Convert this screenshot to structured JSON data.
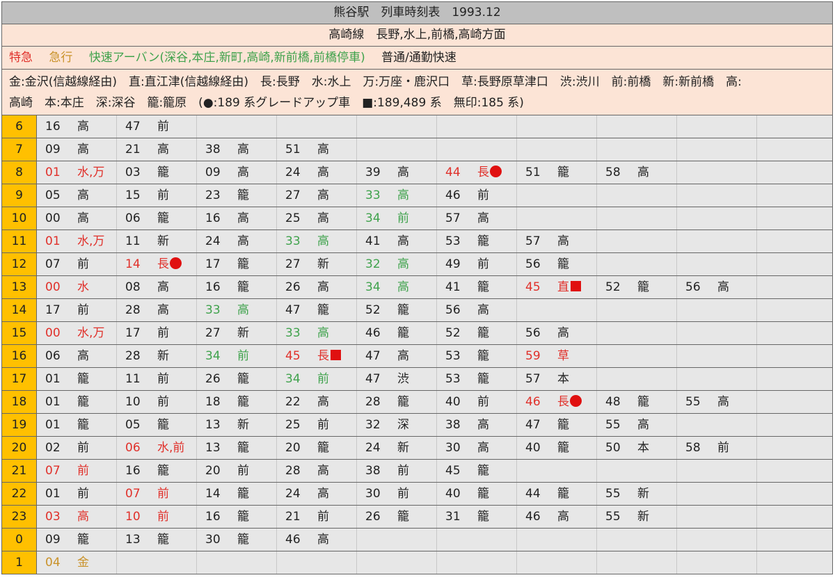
{
  "header": {
    "title": "熊谷駅　列車時刻表　1993.12",
    "line": "高崎線　長野,水上,前橋,高崎方面"
  },
  "legend": {
    "limited": "特急",
    "express": "急行",
    "rapid": "快速アーバン(深谷,本庄,新町,高崎,新前橋,前橋停車)",
    "local": "普通/通勤快速"
  },
  "abbreviations": {
    "line1": "金:金沢(信越線経由)　直:直江津(信越線経由)　長:長野　水:水上　万:万座・鹿沢口　草:長野原草津口　渋:渋川　前:前橋　新:新前橋　高:",
    "line2": "高崎　本:本庄　深:深谷　籠:籠原　(●:189 系グレードアップ車　■:189,489 系　無印:185 系)"
  },
  "colors": {
    "limited": "#e0302a",
    "express": "#c9922a",
    "rapid": "#3fa24c",
    "local": "#222222",
    "hour_bg": "#ffc000",
    "header_bg": "#bfbfbf",
    "info_bg": "#fce4d6"
  },
  "timetable": [
    {
      "hour": "6",
      "deps": [
        {
          "m": "16",
          "d": "高",
          "t": "local"
        },
        {
          "m": "47",
          "d": "前",
          "t": "local"
        }
      ]
    },
    {
      "hour": "7",
      "deps": [
        {
          "m": "09",
          "d": "高",
          "t": "local"
        },
        {
          "m": "21",
          "d": "高",
          "t": "local"
        },
        {
          "m": "38",
          "d": "高",
          "t": "local"
        },
        {
          "m": "51",
          "d": "高",
          "t": "local"
        }
      ]
    },
    {
      "hour": "8",
      "deps": [
        {
          "m": "01",
          "d": "水,万",
          "t": "limited"
        },
        {
          "m": "03",
          "d": "籠",
          "t": "local"
        },
        {
          "m": "09",
          "d": "高",
          "t": "local"
        },
        {
          "m": "24",
          "d": "高",
          "t": "local"
        },
        {
          "m": "39",
          "d": "高",
          "t": "local"
        },
        {
          "m": "44",
          "d": "長",
          "t": "limited",
          "mark": "circle"
        },
        {
          "m": "51",
          "d": "籠",
          "t": "local"
        },
        {
          "m": "58",
          "d": "高",
          "t": "local"
        }
      ]
    },
    {
      "hour": "9",
      "deps": [
        {
          "m": "05",
          "d": "高",
          "t": "local"
        },
        {
          "m": "15",
          "d": "前",
          "t": "local"
        },
        {
          "m": "23",
          "d": "籠",
          "t": "local"
        },
        {
          "m": "27",
          "d": "高",
          "t": "local"
        },
        {
          "m": "33",
          "d": "高",
          "t": "rapid"
        },
        {
          "m": "46",
          "d": "前",
          "t": "local"
        }
      ]
    },
    {
      "hour": "10",
      "deps": [
        {
          "m": "00",
          "d": "高",
          "t": "local"
        },
        {
          "m": "06",
          "d": "籠",
          "t": "local"
        },
        {
          "m": "16",
          "d": "高",
          "t": "local"
        },
        {
          "m": "25",
          "d": "高",
          "t": "local"
        },
        {
          "m": "34",
          "d": "前",
          "t": "rapid"
        },
        {
          "m": "57",
          "d": "高",
          "t": "local"
        }
      ]
    },
    {
      "hour": "11",
      "deps": [
        {
          "m": "01",
          "d": "水,万",
          "t": "limited"
        },
        {
          "m": "11",
          "d": "新",
          "t": "local"
        },
        {
          "m": "24",
          "d": "高",
          "t": "local"
        },
        {
          "m": "33",
          "d": "高",
          "t": "rapid"
        },
        {
          "m": "41",
          "d": "高",
          "t": "local"
        },
        {
          "m": "53",
          "d": "籠",
          "t": "local"
        },
        {
          "m": "57",
          "d": "高",
          "t": "local"
        }
      ]
    },
    {
      "hour": "12",
      "deps": [
        {
          "m": "07",
          "d": "前",
          "t": "local"
        },
        {
          "m": "14",
          "d": "長",
          "t": "limited",
          "mark": "circle"
        },
        {
          "m": "17",
          "d": "籠",
          "t": "local"
        },
        {
          "m": "27",
          "d": "新",
          "t": "local"
        },
        {
          "m": "32",
          "d": "高",
          "t": "rapid"
        },
        {
          "m": "49",
          "d": "前",
          "t": "local"
        },
        {
          "m": "56",
          "d": "籠",
          "t": "local"
        }
      ]
    },
    {
      "hour": "13",
      "deps": [
        {
          "m": "00",
          "d": "水",
          "t": "limited"
        },
        {
          "m": "08",
          "d": "高",
          "t": "local"
        },
        {
          "m": "16",
          "d": "籠",
          "t": "local"
        },
        {
          "m": "26",
          "d": "高",
          "t": "local"
        },
        {
          "m": "34",
          "d": "高",
          "t": "rapid"
        },
        {
          "m": "41",
          "d": "籠",
          "t": "local"
        },
        {
          "m": "45",
          "d": "直",
          "t": "limited",
          "mark": "square"
        },
        {
          "m": "52",
          "d": "籠",
          "t": "local"
        },
        {
          "m": "56",
          "d": "高",
          "t": "local"
        }
      ]
    },
    {
      "hour": "14",
      "deps": [
        {
          "m": "17",
          "d": "前",
          "t": "local"
        },
        {
          "m": "28",
          "d": "高",
          "t": "local"
        },
        {
          "m": "33",
          "d": "高",
          "t": "rapid"
        },
        {
          "m": "47",
          "d": "籠",
          "t": "local"
        },
        {
          "m": "52",
          "d": "籠",
          "t": "local"
        },
        {
          "m": "56",
          "d": "高",
          "t": "local"
        }
      ]
    },
    {
      "hour": "15",
      "deps": [
        {
          "m": "00",
          "d": "水,万",
          "t": "limited"
        },
        {
          "m": "17",
          "d": "前",
          "t": "local"
        },
        {
          "m": "27",
          "d": "新",
          "t": "local"
        },
        {
          "m": "33",
          "d": "高",
          "t": "rapid"
        },
        {
          "m": "46",
          "d": "籠",
          "t": "local"
        },
        {
          "m": "52",
          "d": "籠",
          "t": "local"
        },
        {
          "m": "56",
          "d": "高",
          "t": "local"
        }
      ]
    },
    {
      "hour": "16",
      "deps": [
        {
          "m": "06",
          "d": "高",
          "t": "local"
        },
        {
          "m": "28",
          "d": "新",
          "t": "local"
        },
        {
          "m": "34",
          "d": "前",
          "t": "rapid"
        },
        {
          "m": "45",
          "d": "長",
          "t": "limited",
          "mark": "square"
        },
        {
          "m": "47",
          "d": "高",
          "t": "local"
        },
        {
          "m": "53",
          "d": "籠",
          "t": "local"
        },
        {
          "m": "59",
          "d": "草",
          "t": "limited"
        }
      ]
    },
    {
      "hour": "17",
      "deps": [
        {
          "m": "01",
          "d": "籠",
          "t": "local"
        },
        {
          "m": "11",
          "d": "前",
          "t": "local"
        },
        {
          "m": "26",
          "d": "籠",
          "t": "local"
        },
        {
          "m": "34",
          "d": "前",
          "t": "rapid"
        },
        {
          "m": "47",
          "d": "渋",
          "t": "local"
        },
        {
          "m": "53",
          "d": "籠",
          "t": "local"
        },
        {
          "m": "57",
          "d": "本",
          "t": "local"
        }
      ]
    },
    {
      "hour": "18",
      "deps": [
        {
          "m": "01",
          "d": "籠",
          "t": "local"
        },
        {
          "m": "10",
          "d": "前",
          "t": "local"
        },
        {
          "m": "18",
          "d": "籠",
          "t": "local"
        },
        {
          "m": "22",
          "d": "高",
          "t": "local"
        },
        {
          "m": "28",
          "d": "籠",
          "t": "local"
        },
        {
          "m": "40",
          "d": "前",
          "t": "local"
        },
        {
          "m": "46",
          "d": "長",
          "t": "limited",
          "mark": "circle"
        },
        {
          "m": "48",
          "d": "籠",
          "t": "local"
        },
        {
          "m": "55",
          "d": "高",
          "t": "local"
        }
      ]
    },
    {
      "hour": "19",
      "deps": [
        {
          "m": "01",
          "d": "籠",
          "t": "local"
        },
        {
          "m": "05",
          "d": "籠",
          "t": "local"
        },
        {
          "m": "13",
          "d": "新",
          "t": "local"
        },
        {
          "m": "25",
          "d": "前",
          "t": "local"
        },
        {
          "m": "32",
          "d": "深",
          "t": "local"
        },
        {
          "m": "38",
          "d": "高",
          "t": "local"
        },
        {
          "m": "47",
          "d": "籠",
          "t": "local"
        },
        {
          "m": "55",
          "d": "高",
          "t": "local"
        }
      ]
    },
    {
      "hour": "20",
      "deps": [
        {
          "m": "02",
          "d": "前",
          "t": "local"
        },
        {
          "m": "06",
          "d": "水,前",
          "t": "limited"
        },
        {
          "m": "13",
          "d": "籠",
          "t": "local"
        },
        {
          "m": "20",
          "d": "籠",
          "t": "local"
        },
        {
          "m": "24",
          "d": "新",
          "t": "local"
        },
        {
          "m": "30",
          "d": "高",
          "t": "local"
        },
        {
          "m": "40",
          "d": "籠",
          "t": "local"
        },
        {
          "m": "50",
          "d": "本",
          "t": "local"
        },
        {
          "m": "58",
          "d": "前",
          "t": "local"
        }
      ]
    },
    {
      "hour": "21",
      "deps": [
        {
          "m": "07",
          "d": "前",
          "t": "limited"
        },
        {
          "m": "16",
          "d": "籠",
          "t": "local"
        },
        {
          "m": "20",
          "d": "前",
          "t": "local"
        },
        {
          "m": "28",
          "d": "高",
          "t": "local"
        },
        {
          "m": "38",
          "d": "前",
          "t": "local"
        },
        {
          "m": "45",
          "d": "籠",
          "t": "local"
        }
      ]
    },
    {
      "hour": "22",
      "deps": [
        {
          "m": "01",
          "d": "前",
          "t": "local"
        },
        {
          "m": "07",
          "d": "前",
          "t": "limited"
        },
        {
          "m": "14",
          "d": "籠",
          "t": "local"
        },
        {
          "m": "24",
          "d": "高",
          "t": "local"
        },
        {
          "m": "30",
          "d": "前",
          "t": "local"
        },
        {
          "m": "40",
          "d": "籠",
          "t": "local"
        },
        {
          "m": "44",
          "d": "籠",
          "t": "local"
        },
        {
          "m": "55",
          "d": "新",
          "t": "local"
        }
      ]
    },
    {
      "hour": "23",
      "deps": [
        {
          "m": "03",
          "d": "高",
          "t": "limited"
        },
        {
          "m": "10",
          "d": "前",
          "t": "limited"
        },
        {
          "m": "16",
          "d": "籠",
          "t": "local"
        },
        {
          "m": "21",
          "d": "前",
          "t": "local"
        },
        {
          "m": "26",
          "d": "籠",
          "t": "local"
        },
        {
          "m": "31",
          "d": "籠",
          "t": "local"
        },
        {
          "m": "46",
          "d": "高",
          "t": "local"
        },
        {
          "m": "55",
          "d": "新",
          "t": "local"
        }
      ]
    },
    {
      "hour": "0",
      "deps": [
        {
          "m": "09",
          "d": "籠",
          "t": "local"
        },
        {
          "m": "13",
          "d": "籠",
          "t": "local"
        },
        {
          "m": "30",
          "d": "籠",
          "t": "local"
        },
        {
          "m": "46",
          "d": "高",
          "t": "local"
        }
      ]
    },
    {
      "hour": "1",
      "deps": [
        {
          "m": "04",
          "d": "金",
          "t": "express"
        }
      ]
    }
  ]
}
